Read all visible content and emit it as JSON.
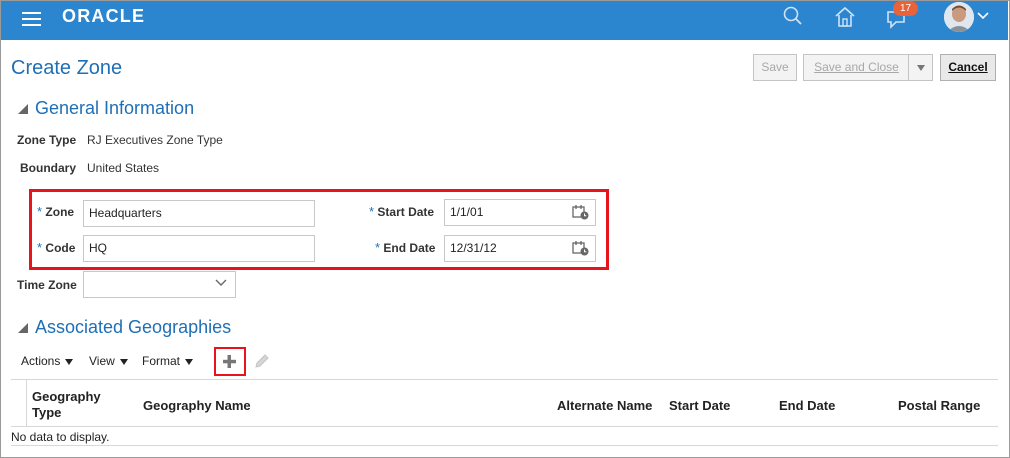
{
  "header": {
    "brand": "ORACLE",
    "notifications_count": "17"
  },
  "page": {
    "title": "Create Zone"
  },
  "toolbar": {
    "save_label": "Save",
    "save_close_label": "Save and Close",
    "cancel_label": "Cancel"
  },
  "general": {
    "section_title": "General Information",
    "zone_type_label": "Zone Type",
    "zone_type_value": "RJ Executives Zone Type",
    "boundary_label": "Boundary",
    "boundary_value": "United States",
    "zone_label": "Zone",
    "zone_value": "Headquarters",
    "code_label": "Code",
    "code_value": "HQ",
    "start_date_label": "Start Date",
    "start_date_value": "1/1/01",
    "end_date_label": "End Date",
    "end_date_value": "12/31/12",
    "time_zone_label": "Time Zone",
    "time_zone_value": "",
    "required_marker": "*"
  },
  "geographies": {
    "section_title": "Associated Geographies",
    "menus": [
      "Actions",
      "View",
      "Format"
    ],
    "columns": [
      "Geography Type",
      "Geography Name",
      "Alternate Name",
      "Start Date",
      "End Date",
      "Postal Range"
    ],
    "empty_text": "No data to display."
  },
  "colors": {
    "header_bg": "#2b86cf",
    "title_blue": "#1f6fb6",
    "highlight_red": "#e8141b",
    "badge": "#e8623a"
  }
}
